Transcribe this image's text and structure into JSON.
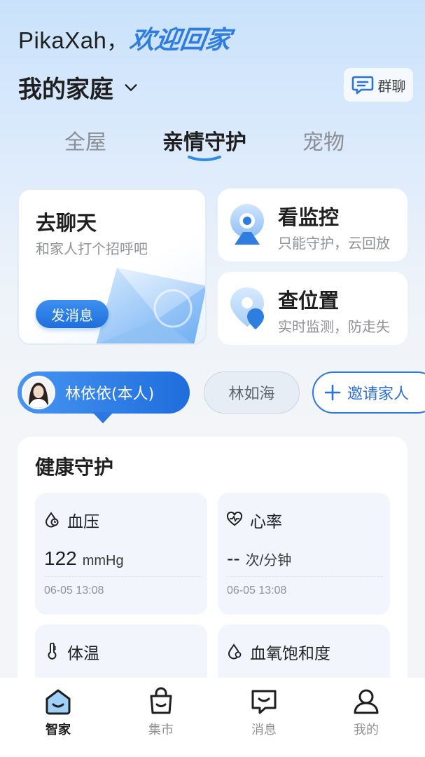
{
  "header": {
    "user_name": "PikaXah",
    "comma": "，",
    "welcome": "欢迎回家",
    "home_name": "我的家庭",
    "group_chat_label": "群聊"
  },
  "tabs": [
    {
      "label": "全屋",
      "active": false
    },
    {
      "label": "亲情守护",
      "active": true
    },
    {
      "label": "宠物",
      "active": false
    }
  ],
  "cards": {
    "chat": {
      "title": "去聊天",
      "subtitle": "和家人打个招呼吧",
      "button": "发消息"
    },
    "monitor": {
      "title": "看监控",
      "subtitle": "只能守护，云回放",
      "icon": "camera-icon"
    },
    "location": {
      "title": "查位置",
      "subtitle": "实时监测，防走失",
      "icon": "location-pin-icon"
    }
  },
  "members": {
    "self": "林依依(本人)",
    "other": "林如海",
    "invite": "邀请家人"
  },
  "health": {
    "title": "健康守护",
    "metrics": [
      {
        "name": "血压",
        "value": "122",
        "unit": "mmHg",
        "time": "06-05 13:08",
        "icon": "blood-pressure-icon"
      },
      {
        "name": "心率",
        "value": "--",
        "unit": "次/分钟",
        "time": "06-05 13:08",
        "icon": "heart-rate-icon"
      },
      {
        "name": "体温",
        "icon": "thermometer-icon"
      },
      {
        "name": "血氧饱和度",
        "icon": "blood-oxygen-icon"
      }
    ]
  },
  "bottom_nav": [
    {
      "label": "智家",
      "active": true,
      "icon": "home-icon"
    },
    {
      "label": "集市",
      "active": false,
      "icon": "shopping-bag-icon"
    },
    {
      "label": "消息",
      "active": false,
      "icon": "message-icon"
    },
    {
      "label": "我的",
      "active": false,
      "icon": "profile-icon"
    }
  ],
  "colors": {
    "accent": "#2f7de1",
    "primary_button": "#1f6fdc",
    "text_primary": "#1f1f1f",
    "text_secondary": "#8e9196"
  }
}
